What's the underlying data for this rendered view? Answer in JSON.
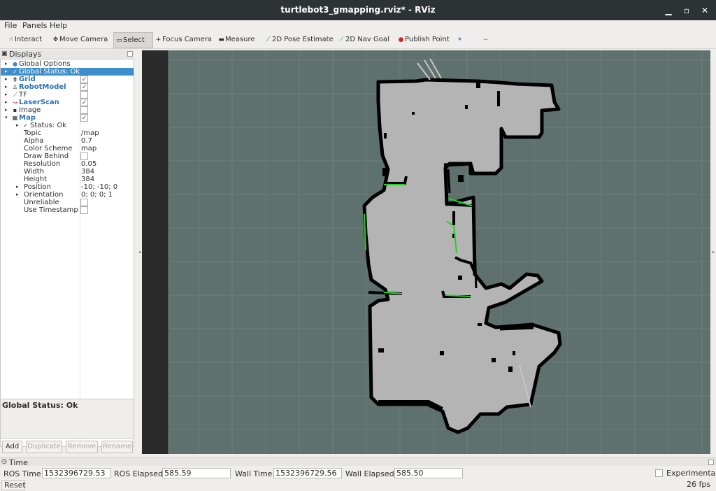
{
  "window": {
    "title": "turtlebot3_gmapping.rviz* - RViz"
  },
  "menu": [
    "File",
    "Panels",
    "Help"
  ],
  "toolbar": {
    "interact": "Interact",
    "move_camera": "Move Camera",
    "select": "Select",
    "focus_camera": "Focus Camera",
    "measure": "Measure",
    "pose_estimate": "2D Pose Estimate",
    "nav_goal": "2D Nav Goal",
    "publish_point": "Publish Point"
  },
  "displays": {
    "header": "Displays",
    "items": [
      {
        "label": "Global Options"
      },
      {
        "label": "Global Status: Ok"
      },
      {
        "label": "Grid",
        "checked": true
      },
      {
        "label": "RobotModel",
        "checked": true
      },
      {
        "label": "TF",
        "checked": false
      },
      {
        "label": "LaserScan",
        "checked": true
      },
      {
        "label": "Image",
        "checked": false
      },
      {
        "label": "Map",
        "checked": true
      }
    ],
    "map_props": [
      {
        "name": "Status: Ok",
        "value": ""
      },
      {
        "name": "Topic",
        "value": "/map"
      },
      {
        "name": "Alpha",
        "value": "0.7"
      },
      {
        "name": "Color Scheme",
        "value": "map"
      },
      {
        "name": "Draw Behind",
        "value": ""
      },
      {
        "name": "Resolution",
        "value": "0.05"
      },
      {
        "name": "Width",
        "value": "384"
      },
      {
        "name": "Height",
        "value": "384"
      },
      {
        "name": "Position",
        "value": "-10; -10; 0"
      },
      {
        "name": "Orientation",
        "value": "0; 0; 0; 1"
      },
      {
        "name": "Unreliable",
        "value": ""
      },
      {
        "name": "Use Timestamp",
        "value": ""
      }
    ],
    "status_title": "Global Status: Ok",
    "buttons": {
      "add": "Add",
      "duplicate": "Duplicate",
      "remove": "Remove",
      "rename": "Rename"
    }
  },
  "time": {
    "header": "Time",
    "ros_time_label": "ROS Time:",
    "ros_time": "1532396729.53",
    "ros_elapsed_label": "ROS Elapsed:",
    "ros_elapsed": "585.59",
    "wall_time_label": "Wall Time:",
    "wall_time": "1532396729.56",
    "wall_elapsed_label": "Wall Elapsed:",
    "wall_elapsed": "585.50",
    "experimental": "Experimental",
    "fps": "26 fps",
    "reset": "Reset"
  },
  "colors": {
    "selection": "#3d8ecb",
    "viewport_bg": "#5f716e",
    "map_free": "#b4b4b4",
    "map_wall": "#000000",
    "laser": "#00cc00"
  }
}
